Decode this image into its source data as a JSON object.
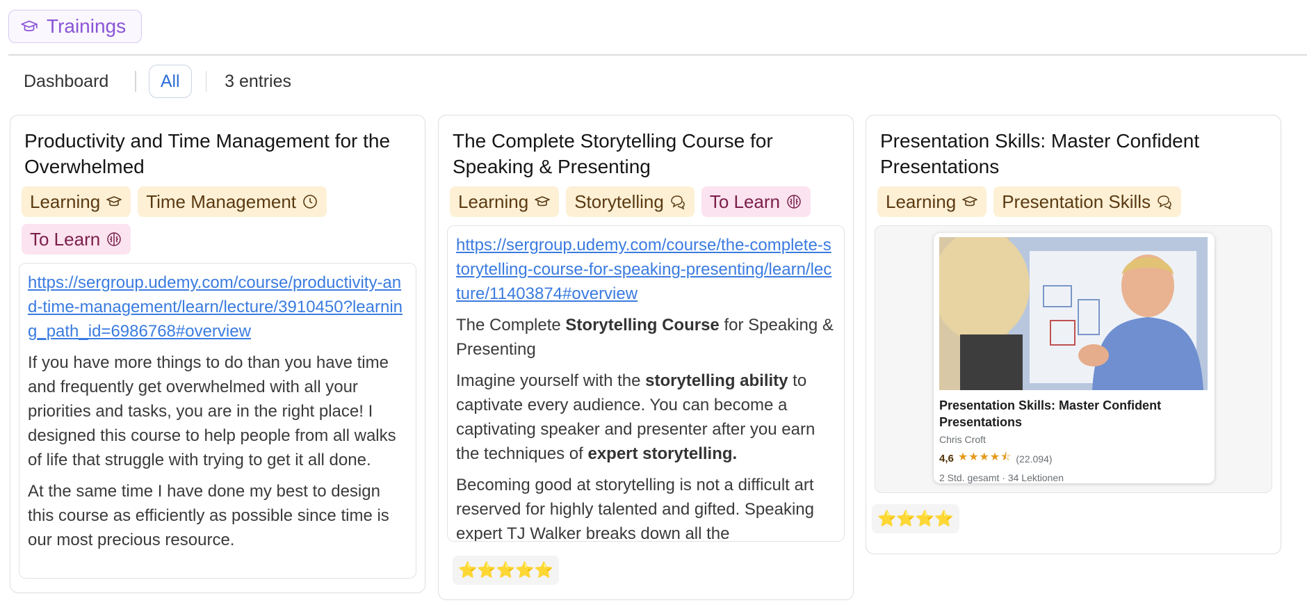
{
  "page": {
    "title": "Trainings",
    "icon": "graduation-cap-icon"
  },
  "viewbar": {
    "dashboard_label": "Dashboard",
    "view_all_label": "All",
    "entries_label": "3 entries"
  },
  "cards": [
    {
      "title": "Productivity and Time Management for the Overwhelmed",
      "tags": [
        {
          "label": "Learning",
          "icon": "graduation-cap-icon",
          "color": "#fdf0d5"
        },
        {
          "label": "Time Management",
          "icon": "clock-icon",
          "color": "#fdf0d5"
        },
        {
          "label": "To Learn",
          "icon": "brain-icon",
          "color": "#fbe3ef"
        }
      ],
      "url": "https://sergroup.udemy.com/course/productivity-and-time-management/learn/lecture/3910450?learning_path_id=6986768#overview",
      "paragraph1": "If you have more things to do than you have time and frequently get overwhelmed with all your priorities and tasks, you are in the right place! I designed this course to help people from all walks of life that struggle with trying to get it all done.",
      "paragraph2": "At the same time I have done my best to design this course as efficiently as possible since time is our most precious resource."
    },
    {
      "title": "The Complete Storytelling Course for Speaking & Presenting",
      "tags": [
        {
          "label": "Learning",
          "icon": "graduation-cap-icon",
          "color": "#fdf0d5"
        },
        {
          "label": "Storytelling",
          "icon": "chat-bubbles-icon",
          "color": "#fdf0d5"
        },
        {
          "label": "To Learn",
          "icon": "brain-icon",
          "color": "#fbe3ef"
        }
      ],
      "url": "https://sergroup.udemy.com/course/the-complete-storytelling-course-for-speaking-presenting/learn/lecture/11403874#overview",
      "heading_pre": "The Complete ",
      "heading_bold": "Storytelling Course",
      "heading_post": " for Speaking & Presenting",
      "p1_a": "Imagine yourself with the ",
      "p1_b": "storytelling ability",
      "p1_c": " to captivate every audience. You can become a captivating speaker and presenter after you earn the techniques of ",
      "p1_d": "expert storytelling.",
      "p2": "Becoming good at storytelling is not a difficult art reserved for highly talented and gifted. Speaking expert TJ Walker breaks down all the",
      "rating": "⭐⭐⭐⭐⭐"
    },
    {
      "title": "Presentation Skills: Master Confident Presentations",
      "tags": [
        {
          "label": "Learning",
          "icon": "graduation-cap-icon",
          "color": "#fdf0d5"
        },
        {
          "label": "Presentation Skills",
          "icon": "chat-bubbles-icon",
          "color": "#fdf0d5"
        }
      ],
      "preview": {
        "title": "Presentation Skills: Master Confident Presentations",
        "author": "Chris Croft",
        "rating_value": "4,6",
        "rating_stars": "★★★★⯪",
        "rating_count": "(22.094)",
        "meta": "2 Std. gesamt · 34 Lektionen"
      },
      "rating": "⭐⭐⭐⭐"
    }
  ]
}
